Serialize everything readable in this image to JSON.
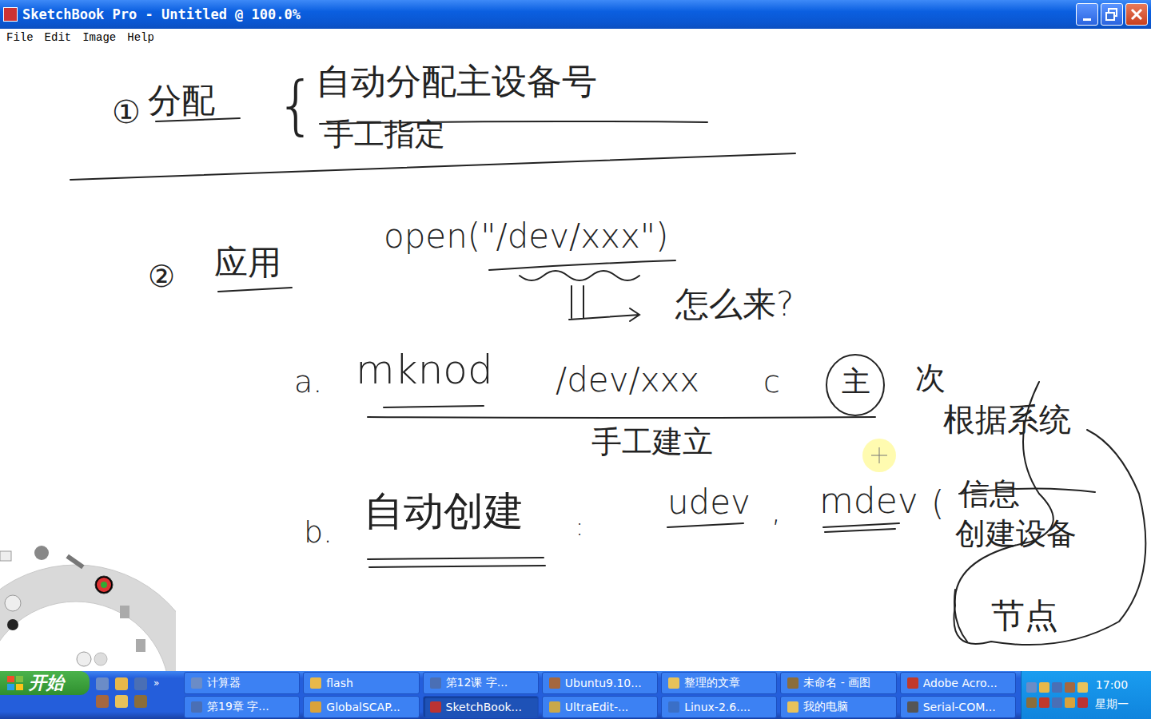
{
  "window": {
    "title": "SketchBook Pro - Untitled @ 100.0%"
  },
  "menu": [
    "File",
    "Edit",
    "Image",
    "Help"
  ],
  "canvas": {
    "notes": [
      "①",
      "分配",
      "{",
      "自动分配主设备号",
      "手工指定",
      "②",
      "应用",
      "open(\"/dev/xxx\")",
      "怎么来?",
      "a.",
      "mknod",
      "/dev/xxx",
      "c",
      "主",
      "次",
      "手工建立",
      "b.",
      "自动创建",
      ":",
      "udev",
      ",",
      "mdev",
      "(",
      "根据系统",
      "信息",
      "创建设备",
      "节点"
    ]
  },
  "taskbar": {
    "start": "开始",
    "quick_launch_more": "»",
    "buttons": [
      {
        "label": "计算器",
        "selected": false
      },
      {
        "label": "flash",
        "selected": false
      },
      {
        "label": "第12课 字...",
        "selected": false
      },
      {
        "label": "Ubuntu9.10...",
        "selected": false
      },
      {
        "label": "整理的文章",
        "selected": false
      },
      {
        "label": "未命名 - 画图",
        "selected": false
      },
      {
        "label": "Adobe Acro...",
        "selected": false
      },
      {
        "label": "第19章 字...",
        "selected": false
      },
      {
        "label": "GlobalSCAP...",
        "selected": false
      },
      {
        "label": "SketchBook...",
        "selected": true
      },
      {
        "label": "UltraEdit-...",
        "selected": false
      },
      {
        "label": "Linux-2.6....",
        "selected": false
      },
      {
        "label": "我的电脑",
        "selected": false
      },
      {
        "label": "Serial-COM...",
        "selected": false
      }
    ],
    "clock": {
      "time": "17:00",
      "day": "星期一"
    }
  }
}
